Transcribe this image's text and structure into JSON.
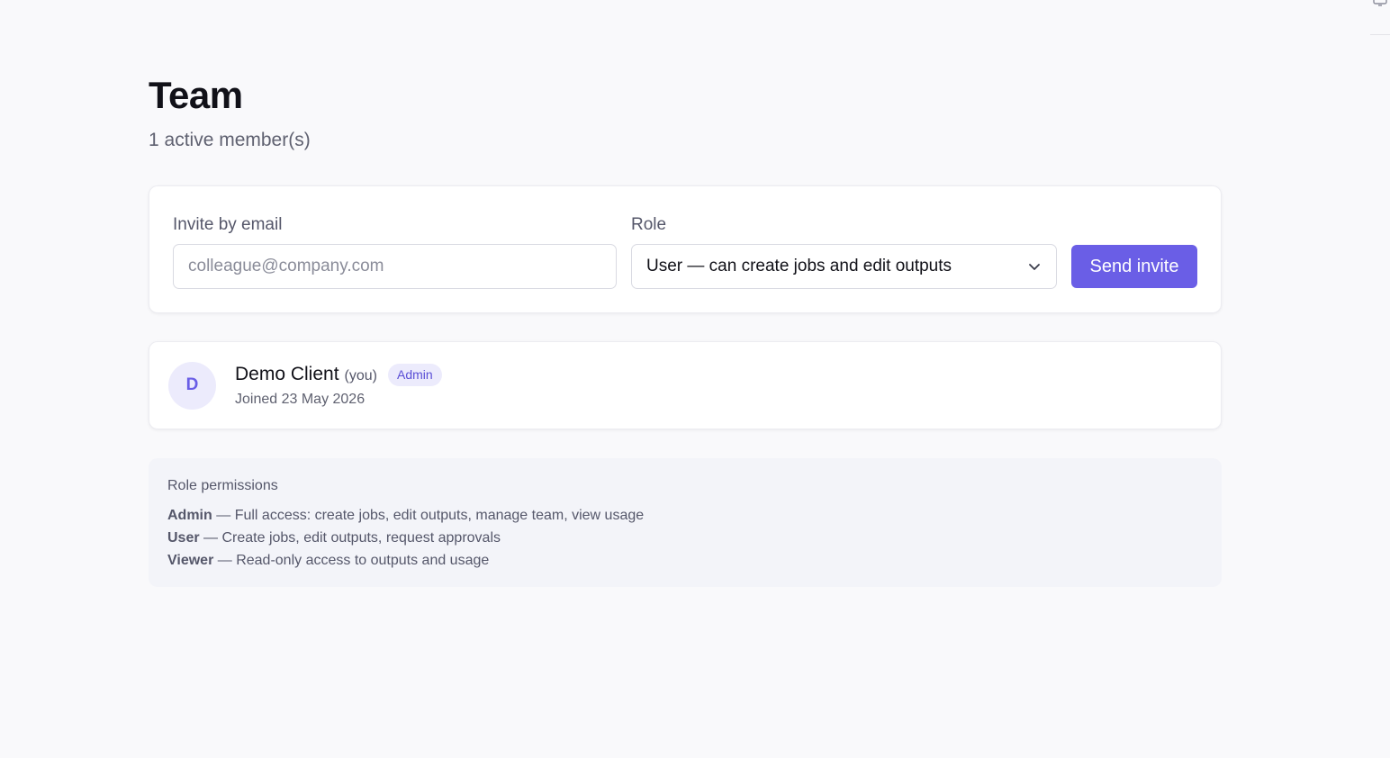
{
  "page": {
    "title": "Team",
    "subtitle": "1 active member(s)"
  },
  "invite": {
    "email_label": "Invite by email",
    "email_placeholder": "colleague@company.com",
    "email_value": "",
    "role_label": "Role",
    "role_selected": "User — can create jobs and edit outputs",
    "send_button_label": "Send invite"
  },
  "members": [
    {
      "avatar_initial": "D",
      "name": "Demo Client",
      "you_label": "(you)",
      "role_badge": "Admin",
      "joined": "Joined 23 May 2026"
    }
  ],
  "permissions": {
    "title": "Role permissions",
    "roles": [
      {
        "role": "Admin",
        "description": "Full access: create jobs, edit outputs, manage team, view usage"
      },
      {
        "role": "User",
        "description": "Create jobs, edit outputs, request approvals"
      },
      {
        "role": "Viewer",
        "description": "Read-only access to outputs and usage"
      }
    ]
  },
  "icons": {
    "select_chevron": "chevron-down-icon",
    "corner": "notification-icon"
  },
  "colors": {
    "accent": "#6a5ee6",
    "background": "#f9f9fb",
    "badge_bg": "#ecebfc"
  }
}
